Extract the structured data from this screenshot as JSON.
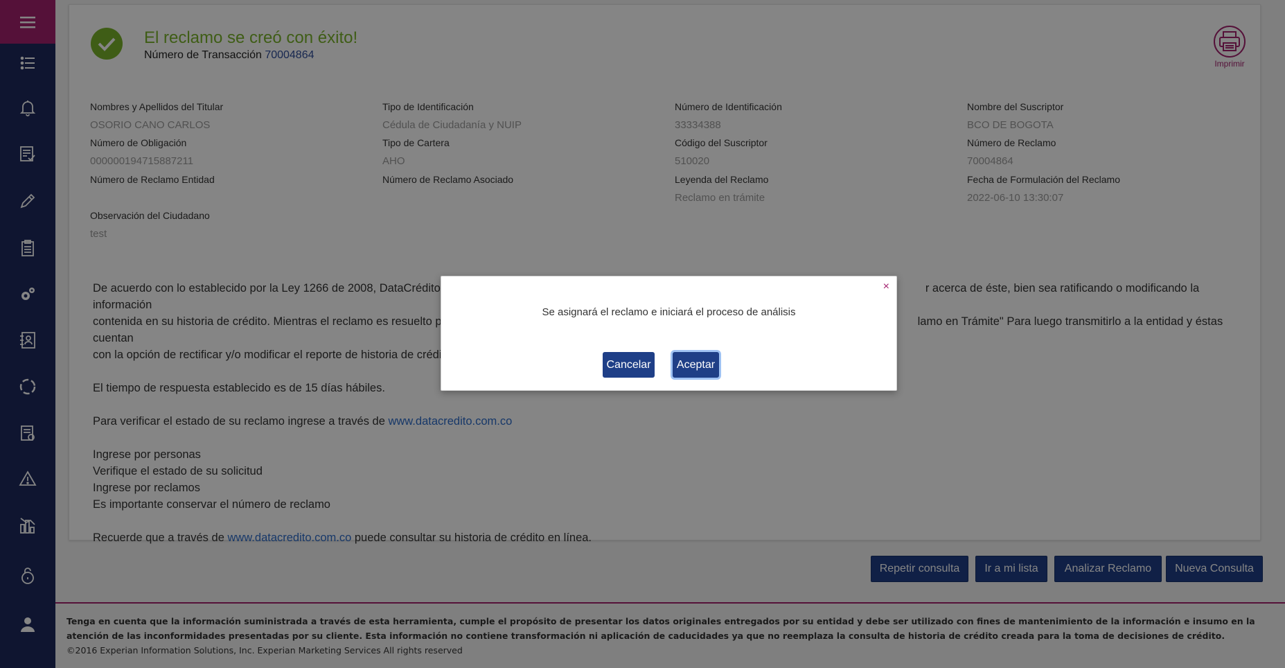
{
  "header": {
    "title": "El reclamo se creó con éxito!",
    "transaction_label": "Número de Transacción",
    "transaction_number": "70004864",
    "print_label": "Imprimir"
  },
  "fields": {
    "titular_label": "Nombres y Apellidos del Titular",
    "titular_value": "OSORIO CANO CARLOS",
    "tipo_id_label": "Tipo de Identificación",
    "tipo_id_value": "Cédula de Ciudadanía y NUIP",
    "num_id_label": "Número de Identificación",
    "num_id_value": "33334388",
    "suscriptor_label": "Nombre del Suscriptor",
    "suscriptor_value": "BCO DE BOGOTA",
    "obligacion_label": "Número de Obligación",
    "obligacion_value": "000000194715887211",
    "cartera_label": "Tipo de Cartera",
    "cartera_value": "AHO",
    "cod_suscriptor_label": "Código del Suscriptor",
    "cod_suscriptor_value": "510020",
    "num_reclamo_label": "Número de Reclamo",
    "num_reclamo_value": "70004864",
    "reclamo_entidad_label": "Número de Reclamo Entidad",
    "reclamo_asociado_label": "Número de Reclamo Asociado",
    "leyenda_label": "Leyenda del Reclamo",
    "leyenda_value": "Reclamo en trámite",
    "fecha_label": "Fecha de Formulación del Reclamo",
    "fecha_value": "2022-06-10 13:30:07",
    "observacion_label": "Observación del Ciudadano",
    "observacion_value": "test"
  },
  "body": {
    "p1_line1_a": "De acuerdo con lo establecido por la Ley 1266 de 2008, DataCrédito tras",
    "p1_line1_b": "r acerca de éste, bien sea ratificando o modificando la información",
    "p1_line2_a": "contenida en su historia de crédito. Mientras el reclamo es resuelto por la",
    "p1_line2_b": "lamo en Trámite\" Para luego transmitirlo a la entidad y éstas cuentan",
    "p1_line3_a": "con la opción de rectificar y/o modificar el reporte de historia de crédito di",
    "p2": "El tiempo de respuesta establecido es de 15 días hábiles.",
    "p3_prefix": "Para verificar el estado de su reclamo ingrese a través de ",
    "p3_link": "www.datacredito.com.co",
    "list_1": "Ingrese por personas",
    "list_2": "Verifique el estado de su solicitud",
    "list_3": "Ingrese por reclamos",
    "list_4": "Es importante conservar el número de reclamo",
    "p5_prefix": "Recuerde que a través de ",
    "p5_link": "www.datacredito.com.co",
    "p5_suffix": " puede consultar su historia de crédito en línea."
  },
  "actions": {
    "repetir": "Repetir consulta",
    "ir_lista": "Ir a mi lista",
    "analizar": "Analizar Reclamo",
    "nueva": "Nueva Consulta"
  },
  "footer": {
    "notice": "Tenga en cuenta que la información suministrada a través de esta herramienta, cumple el propósito de presentar los datos originales entregados por su entidad y debe ser utilizado con fines de mantenimiento de la información e insumo en la atención de las inconformidades presentadas por su cliente. Esta información no contiene transformación ni aplicación de caducidades ya que no reemplaza la consulta de historia de crédito creada para la toma de decisiones de crédito.",
    "copyright": "©2016 Experian Information Solutions, Inc. Experian Marketing Services All rights reserved"
  },
  "modal": {
    "close": "×",
    "message": "Se asignará el reclamo e iniciará el proceso de análisis",
    "cancel": "Cancelar",
    "accept": "Aceptar"
  },
  "sidebar": {
    "icons": [
      "menu-icon",
      "list-icon",
      "bell-icon",
      "checklist-icon",
      "pencil-icon",
      "clipboard-icon",
      "gears-icon",
      "contacts-book-icon",
      "refresh-circle-icon",
      "document-icon",
      "warning-icon",
      "chart-icon",
      "lock-icon",
      "user-icon"
    ]
  },
  "colors": {
    "sidebar": "#1d2a5c",
    "accent": "#a3216e",
    "success": "#7ab32b",
    "button": "#1f3f87",
    "link": "#2c6bc9"
  }
}
